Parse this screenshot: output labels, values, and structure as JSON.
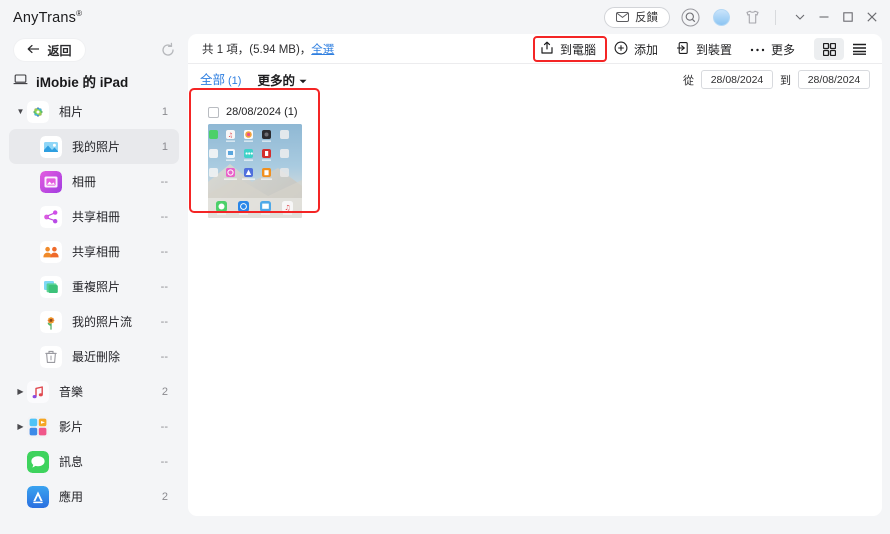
{
  "app": {
    "title": "AnyTrans",
    "title_sup": "®"
  },
  "titlebar": {
    "feedback_label": "反饋",
    "icons": [
      "envelope-icon",
      "search-icon",
      "avatar",
      "shirt-icon",
      "chevron-down-icon",
      "minimize-icon",
      "maximize-icon",
      "close-icon"
    ]
  },
  "nav": {
    "back_label": "返回",
    "refresh_name": "refresh-icon"
  },
  "sidebar": {
    "device": {
      "label": "iMobie 的 iPad",
      "icon": "ipad-icon"
    },
    "items": [
      {
        "label": "相片",
        "count": "1",
        "icon": "photos-icon",
        "caret": "▼",
        "indent": false,
        "selected": false
      },
      {
        "label": "我的照片",
        "count": "1",
        "icon": "my-photos-icon",
        "caret": "",
        "indent": true,
        "selected": true
      },
      {
        "label": "相冊",
        "count": "--",
        "icon": "albums-icon",
        "caret": "",
        "indent": true,
        "selected": false
      },
      {
        "label": "共享相冊",
        "count": "--",
        "icon": "shared-album-icon",
        "caret": "",
        "indent": true,
        "selected": false
      },
      {
        "label": "共享相冊",
        "count": "--",
        "icon": "shared-people-icon",
        "caret": "",
        "indent": true,
        "selected": false
      },
      {
        "label": "重複照片",
        "count": "--",
        "icon": "duplicate-photos-icon",
        "caret": "",
        "indent": true,
        "selected": false
      },
      {
        "label": "我的照片流",
        "count": "--",
        "icon": "photo-stream-icon",
        "caret": "",
        "indent": true,
        "selected": false
      },
      {
        "label": "最近刪除",
        "count": "--",
        "icon": "trash-icon",
        "caret": "",
        "indent": true,
        "selected": false
      },
      {
        "label": "音樂",
        "count": "2",
        "icon": "music-icon",
        "caret": "▶",
        "indent": false,
        "selected": false
      },
      {
        "label": "影片",
        "count": "--",
        "icon": "videos-icon",
        "caret": "▶",
        "indent": false,
        "selected": false
      },
      {
        "label": "訊息",
        "count": "--",
        "icon": "messages-icon",
        "caret": "",
        "indent": false,
        "selected": false
      },
      {
        "label": "應用",
        "count": "2",
        "icon": "apps-icon",
        "caret": "",
        "indent": false,
        "selected": false
      }
    ]
  },
  "main": {
    "info": {
      "summary": "共 1 項，(5.94 MB)，",
      "select_all": "全選"
    },
    "toolbar": [
      {
        "label": "到電腦",
        "icon": "export-to-computer-icon",
        "highlighted": true
      },
      {
        "label": "添加",
        "icon": "add-circle-icon",
        "highlighted": false
      },
      {
        "label": "到裝置",
        "icon": "to-device-icon",
        "highlighted": false
      },
      {
        "label": "更多",
        "icon": "more-dots-icon",
        "highlighted": false
      }
    ],
    "view_buttons": [
      {
        "name": "grid-view-button",
        "active": true
      },
      {
        "name": "list-view-button",
        "active": false
      }
    ],
    "filter": {
      "all_label": "全部",
      "all_count": "(1)",
      "more_label": "更多的",
      "from_label": "從",
      "from_date": "28/08/2024",
      "to_label": "到",
      "to_date": "28/08/2024"
    },
    "groups": [
      {
        "date_label": "28/08/2024 (1)",
        "checked": false,
        "thumb_alt": "ipad-home-screen-screenshot"
      }
    ]
  },
  "colors": {
    "accent_blue": "#2f7fe0",
    "highlight_red": "#f42525",
    "sidebar_bg": "#f4f5f7",
    "panel_bg": "#ffffff",
    "selected_row": "#e8e9ec"
  }
}
